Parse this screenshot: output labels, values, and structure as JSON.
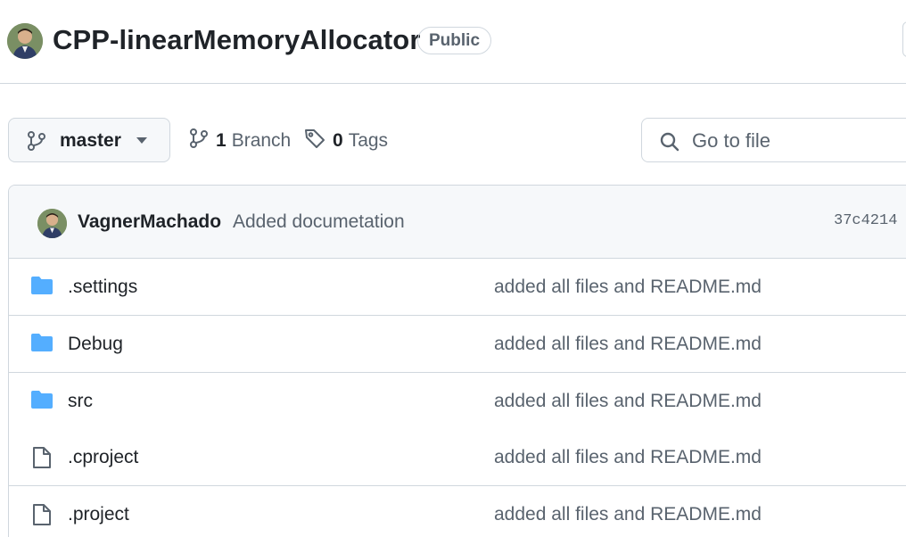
{
  "repo": {
    "name": "CPP-linearMemoryAllocator",
    "visibility": "Public"
  },
  "branch_selector": {
    "current": "master"
  },
  "meta": {
    "branch_count": "1",
    "branch_label": "Branch",
    "tag_count": "0",
    "tag_label": "Tags"
  },
  "search": {
    "placeholder": "Go to file"
  },
  "latest_commit": {
    "author": "VagnerMachado",
    "message": "Added documetation",
    "hash": "37c4214 ·"
  },
  "files": [
    {
      "name": ".settings",
      "type": "folder",
      "commit": "added all files and README.md"
    },
    {
      "name": "Debug",
      "type": "folder",
      "commit": "added all files and README.md"
    },
    {
      "name": "src",
      "type": "folder",
      "commit": "added all files and README.md"
    },
    {
      "name": ".cproject",
      "type": "file",
      "commit": "added all files and README.md"
    },
    {
      "name": ".project",
      "type": "file",
      "commit": "added all files and README.md"
    }
  ],
  "colors": {
    "folder": "#54aeff",
    "border": "#d0d7de",
    "muted_text": "#59636e",
    "header_bg": "#f6f8fa"
  }
}
